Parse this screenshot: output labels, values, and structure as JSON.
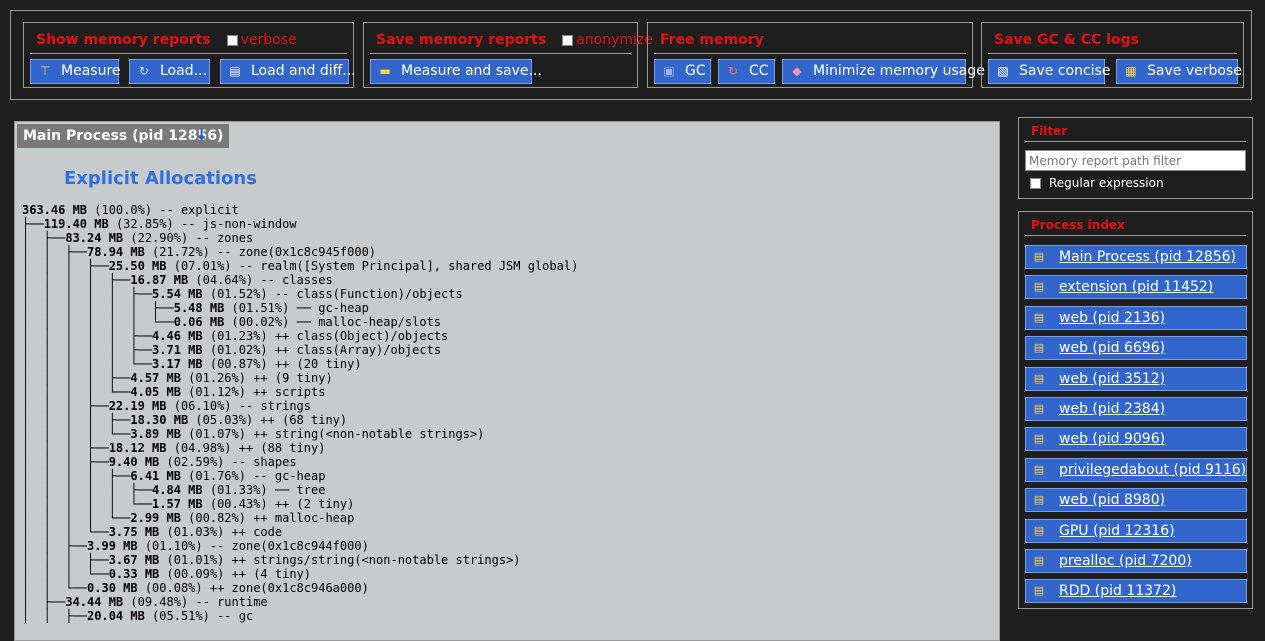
{
  "ops": {
    "show": {
      "title": "Show memory reports",
      "checkbox_label": "verbose",
      "buttons": [
        "Measure",
        "Load...",
        "Load and diff..."
      ]
    },
    "save": {
      "title": "Save memory reports",
      "checkbox_label": "anonymize",
      "buttons": [
        "Measure and save..."
      ]
    },
    "free": {
      "title": "Free memory",
      "buttons": [
        "GC",
        "CC",
        "Minimize memory usage"
      ]
    },
    "gccc": {
      "title": "Save GC & CC logs",
      "buttons": [
        "Save concise",
        "Save verbose"
      ]
    }
  },
  "main": {
    "process_title": "Main Process (pid 12856)",
    "arrow": "↓",
    "section_title": "Explicit Allocations",
    "tree": [
      {
        "prefix": "",
        "size": "363.46 MB",
        "rest": " (100.0%) -- explicit"
      },
      {
        "prefix": "├──",
        "size": "119.40 MB",
        "rest": " (32.85%) -- js-non-window"
      },
      {
        "prefix": "│  ├──",
        "size": "83.24 MB",
        "rest": " (22.90%) -- zones"
      },
      {
        "prefix": "│  │  ├──",
        "size": "78.94 MB",
        "rest": " (21.72%) -- zone(0x1c8c945f000)"
      },
      {
        "prefix": "│  │  │  ├──",
        "size": "25.50 MB",
        "rest": " (07.01%) -- realm([System Principal], shared JSM global)"
      },
      {
        "prefix": "│  │  │  │  ├──",
        "size": "16.87 MB",
        "rest": " (04.64%) -- classes"
      },
      {
        "prefix": "│  │  │  │  │  ├──",
        "size": "5.54 MB",
        "rest": " (01.52%) -- class(Function)/objects"
      },
      {
        "prefix": "│  │  │  │  │  │  ├──",
        "size": "5.48 MB",
        "rest": " (01.51%) ── gc-heap"
      },
      {
        "prefix": "│  │  │  │  │  │  └──",
        "size": "0.06 MB",
        "rest": " (00.02%) ── malloc-heap/slots"
      },
      {
        "prefix": "│  │  │  │  │  ├──",
        "size": "4.46 MB",
        "rest": " (01.23%) ++ class(Object)/objects"
      },
      {
        "prefix": "│  │  │  │  │  ├──",
        "size": "3.71 MB",
        "rest": " (01.02%) ++ class(Array)/objects"
      },
      {
        "prefix": "│  │  │  │  │  └──",
        "size": "3.17 MB",
        "rest": " (00.87%) ++ (20 tiny)"
      },
      {
        "prefix": "│  │  │  │  ├──",
        "size": "4.57 MB",
        "rest": " (01.26%) ++ (9 tiny)"
      },
      {
        "prefix": "│  │  │  │  └──",
        "size": "4.05 MB",
        "rest": " (01.12%) ++ scripts"
      },
      {
        "prefix": "│  │  │  ├──",
        "size": "22.19 MB",
        "rest": " (06.10%) -- strings"
      },
      {
        "prefix": "│  │  │  │  ├──",
        "size": "18.30 MB",
        "rest": " (05.03%) ++ (68 tiny)"
      },
      {
        "prefix": "│  │  │  │  └──",
        "size": "3.89 MB",
        "rest": " (01.07%) ++ string(<non-notable strings>)"
      },
      {
        "prefix": "│  │  │  ├──",
        "size": "18.12 MB",
        "rest": " (04.98%) ++ (88 tiny)"
      },
      {
        "prefix": "│  │  │  ├──",
        "size": "9.40 MB",
        "rest": " (02.59%) -- shapes"
      },
      {
        "prefix": "│  │  │  │  ├──",
        "size": "6.41 MB",
        "rest": " (01.76%) -- gc-heap"
      },
      {
        "prefix": "│  │  │  │  │  ├──",
        "size": "4.84 MB",
        "rest": " (01.33%) ── tree"
      },
      {
        "prefix": "│  │  │  │  │  └──",
        "size": "1.57 MB",
        "rest": " (00.43%) ++ (2 tiny)"
      },
      {
        "prefix": "│  │  │  │  └──",
        "size": "2.99 MB",
        "rest": " (00.82%) ++ malloc-heap"
      },
      {
        "prefix": "│  │  │  └──",
        "size": "3.75 MB",
        "rest": " (01.03%) ++ code"
      },
      {
        "prefix": "│  │  ├──",
        "size": "3.99 MB",
        "rest": " (01.10%) -- zone(0x1c8c944f000)"
      },
      {
        "prefix": "│  │  │  ├──",
        "size": "3.67 MB",
        "rest": " (01.01%) ++ strings/string(<non-notable strings>)"
      },
      {
        "prefix": "│  │  │  └──",
        "size": "0.33 MB",
        "rest": " (00.09%) ++ (4 tiny)"
      },
      {
        "prefix": "│  │  └──",
        "size": "0.30 MB",
        "rest": " (00.08%) ++ zone(0x1c8c946a000)"
      },
      {
        "prefix": "│  ├──",
        "size": "34.44 MB",
        "rest": " (09.48%) -- runtime"
      },
      {
        "prefix": "│  │  ├──",
        "size": "20.04 MB",
        "rest": " (05.51%) -- gc"
      }
    ]
  },
  "filter": {
    "title": "Filter",
    "placeholder": "Memory report path filter",
    "regex_label": "Regular expression"
  },
  "process_index": {
    "title": "Process index",
    "items": [
      "Main Process (pid 12856)",
      "extension (pid 11452)",
      "web (pid 2136)",
      "web (pid 6696)",
      "web (pid 3512)",
      "web (pid 2384)",
      "web (pid 9096)",
      "privilegedabout (pid 9116)",
      "web (pid 8980)",
      "GPU (pid 12316)",
      "prealloc (pid 7200)",
      "RDD (pid 11372)"
    ]
  },
  "colors": {
    "accent_red": "#e81010",
    "button_blue": "#3366cc",
    "section_blue": "#2f6fe0"
  }
}
